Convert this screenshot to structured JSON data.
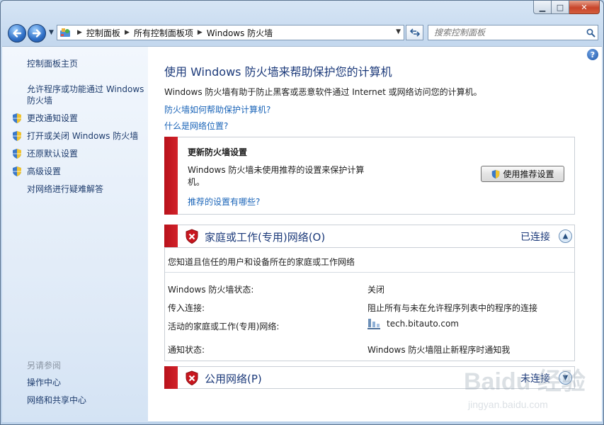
{
  "window": {
    "caption": {
      "minimize": "▁",
      "maximize": "□",
      "close": "✕"
    }
  },
  "nav": {
    "back_icon": "back-arrow-icon",
    "forward_icon": "forward-arrow-icon",
    "address": {
      "crumbs": [
        "控制面板",
        "所有控制面板项",
        "Windows 防火墙"
      ]
    },
    "refresh_icon": "refresh-icon",
    "search": {
      "placeholder": "搜索控制面板"
    }
  },
  "sidebar": {
    "home": "控制面板主页",
    "allow_program": [
      "允许程序或功能通过 Windows",
      "防火墙"
    ],
    "items": [
      {
        "label": "更改通知设置",
        "icon": "uac-shield-icon"
      },
      {
        "label": "打开或关闭 Windows 防火墙",
        "icon": "uac-shield-icon"
      },
      {
        "label": "还原默认设置",
        "icon": "uac-shield-icon"
      },
      {
        "label": "高级设置",
        "icon": "uac-shield-icon"
      }
    ],
    "troubleshoot": "对网络进行疑难解答",
    "see_also": {
      "heading": "另请参阅",
      "links": [
        "操作中心",
        "网络和共享中心"
      ]
    }
  },
  "main": {
    "title": "使用 Windows 防火墙来帮助保护您的计算机",
    "description": "Windows 防火墙有助于防止黑客或恶意软件通过 Internet 或网络访问您的计算机。",
    "link_how": "防火墙如何帮助保护计算机?",
    "link_location": "什么是网络位置?",
    "update_panel": {
      "title": "更新防火墙设置",
      "text": "Windows 防火墙未使用推荐的设置来保护计算机。",
      "link": "推荐的设置有哪些?",
      "button": "使用推荐设置"
    },
    "home_network": {
      "title": "家庭或工作(专用)网络(O)",
      "state": "已连接",
      "subtitle": "您知道且信任的用户和设备所在的家庭或工作网络",
      "rows": [
        {
          "label": "Windows 防火墙状态:",
          "value": "关闭"
        },
        {
          "label": "传入连接:",
          "value": "阻止所有与未在允许程序列表中的程序的连接"
        },
        {
          "label": "活动的家庭或工作(专用)网络:",
          "value": "tech.bitauto.com"
        },
        {
          "label": "通知状态:",
          "value": "Windows 防火墙阻止新程序时通知我"
        }
      ]
    },
    "public_network": {
      "title": "公用网络(P)",
      "state": "未连接"
    }
  },
  "watermark": {
    "text": "Baidu 经验",
    "url_text": "jingyan.baidu.com"
  },
  "colors": {
    "link": "#1a64b8",
    "heading": "#1c3a7a",
    "alert_red": "#c8161e"
  }
}
